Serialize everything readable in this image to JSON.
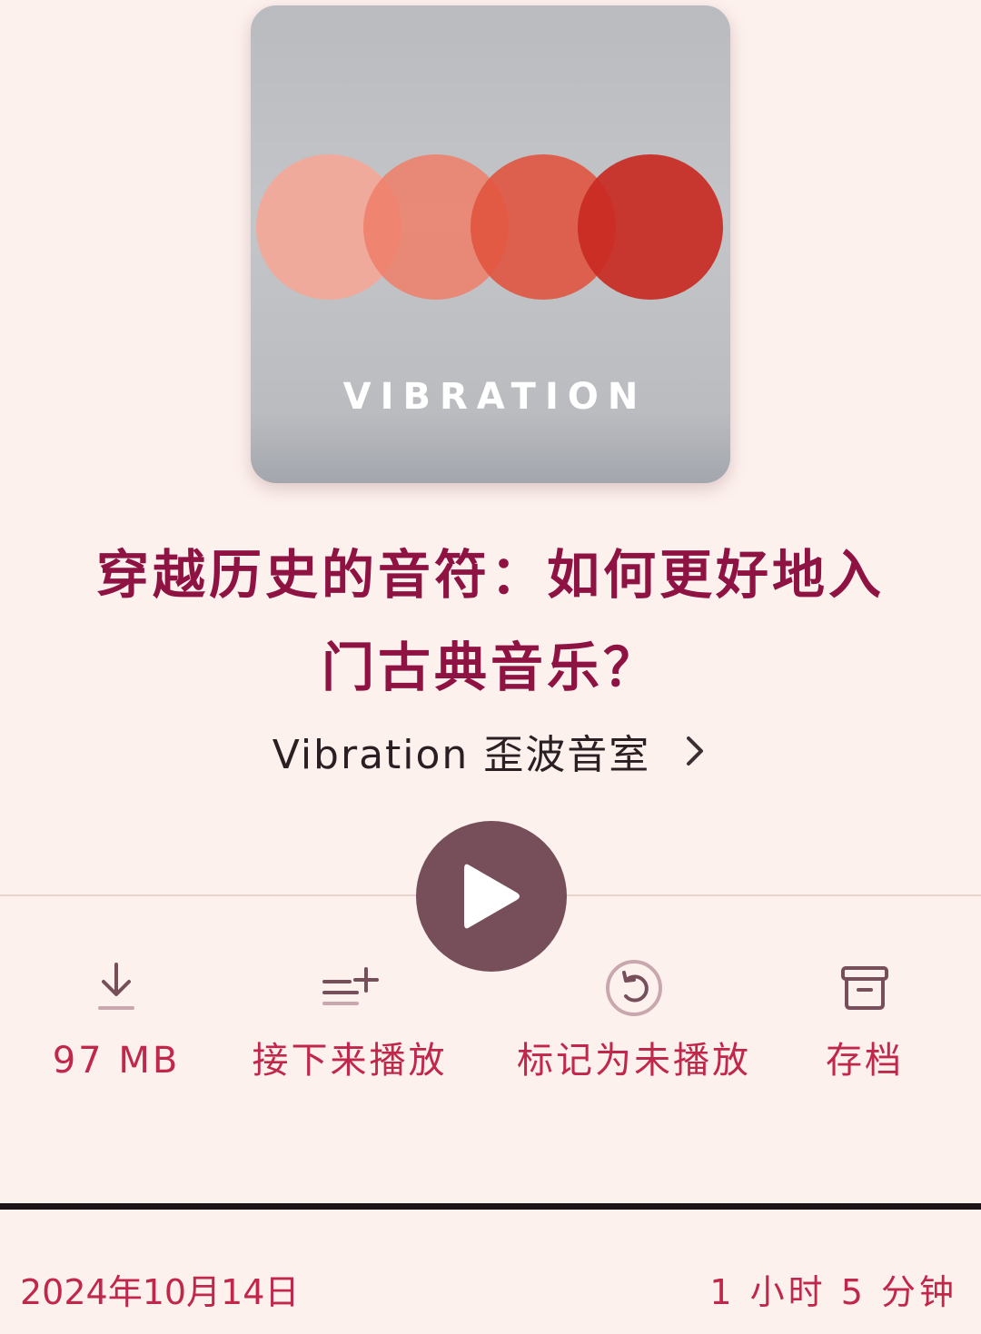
{
  "artwork": {
    "label": "VIBRATION",
    "circle_colors": [
      "#f2a99a",
      "#ef7f68",
      "#e0523e",
      "#c82a22"
    ]
  },
  "episode": {
    "title_line1": "穿越历史的音符：如何更好地入",
    "title_line2": "门古典音乐？"
  },
  "podcast": {
    "name": "Vibration 歪波音室",
    "chevron_icon": "chevron-right-icon"
  },
  "player": {
    "play_icon": "play-icon",
    "progress_fraction": 1.0
  },
  "actions": {
    "download": {
      "icon": "download-icon",
      "label": "97 MB"
    },
    "play_next": {
      "icon": "queue-add-icon",
      "label": "接下来播放"
    },
    "mark_unplayed": {
      "icon": "mark-unplayed-icon",
      "label": "标记为未播放"
    },
    "archive": {
      "icon": "archive-icon",
      "label": "存档"
    }
  },
  "meta": {
    "date": "2024年10月14日",
    "duration": "1 小时 5 分钟"
  },
  "colors": {
    "background": "#fdf1ee",
    "title": "#8e1242",
    "accent": "#c1274a",
    "play_button": "#774f5b"
  }
}
